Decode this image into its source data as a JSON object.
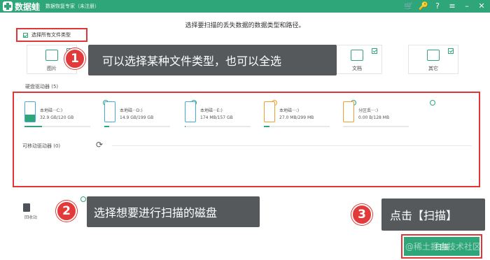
{
  "app": {
    "name": "数据蛙",
    "subtitle": "数据恢复专家（未注册）"
  },
  "titlebar_icons": [
    "cart-icon",
    "key-icon",
    "help-icon",
    "menu-icon",
    "minimize-icon",
    "close-icon"
  ],
  "instruction": "选择要扫描的丢失数据的数据类型和路径。",
  "select_all": {
    "label": "选择所有文件类型",
    "checked": true
  },
  "file_types": [
    {
      "label": "图片",
      "icon": "image-icon"
    },
    {
      "label": "",
      "icon": "audio-icon"
    },
    {
      "label": "",
      "icon": "video-icon"
    },
    {
      "label": "",
      "icon": "email-icon"
    },
    {
      "label": "文档",
      "icon": "document-icon"
    },
    {
      "label": "其它",
      "icon": "other-icon"
    }
  ],
  "callouts": [
    {
      "number": "1",
      "text": "可以选择某种文件类型，也可以全选"
    },
    {
      "number": "2",
      "text": "选择想要进行扫描的磁盘"
    },
    {
      "number": "3",
      "text": "点击【扫描】"
    }
  ],
  "drives_section": {
    "title": "硬盘驱动器 (5)"
  },
  "drives": [
    {
      "name": "本地磁···C:)",
      "size": "32.9 GB/120 GB",
      "selected": true,
      "usage": 0.27
    },
    {
      "name": "本地磁···D:)",
      "size": "14.9 GB/199 GB",
      "selected": false,
      "usage": 0.07
    },
    {
      "name": "本地磁···E:)",
      "size": "174 MB/157 GB",
      "selected": false,
      "usage": 0.01
    },
    {
      "name": "本地磁···:)",
      "size": "27.0 MB/299 MB",
      "selected": false,
      "usage": 0.09
    },
    {
      "name": "分区丢···:)",
      "size": "0.00  B/128 MB",
      "selected": false,
      "usage": 0.0
    }
  ],
  "removable": {
    "title": "可移动驱动器 (0)"
  },
  "recycle_bin": {
    "label": "回收站"
  },
  "scan_button": {
    "label": "扫描"
  },
  "watermark": "@稀土掘金技术社区",
  "colors": {
    "brand": "#2fa57a",
    "highlight": "#e0363a",
    "callout_bg": "#56595c"
  }
}
